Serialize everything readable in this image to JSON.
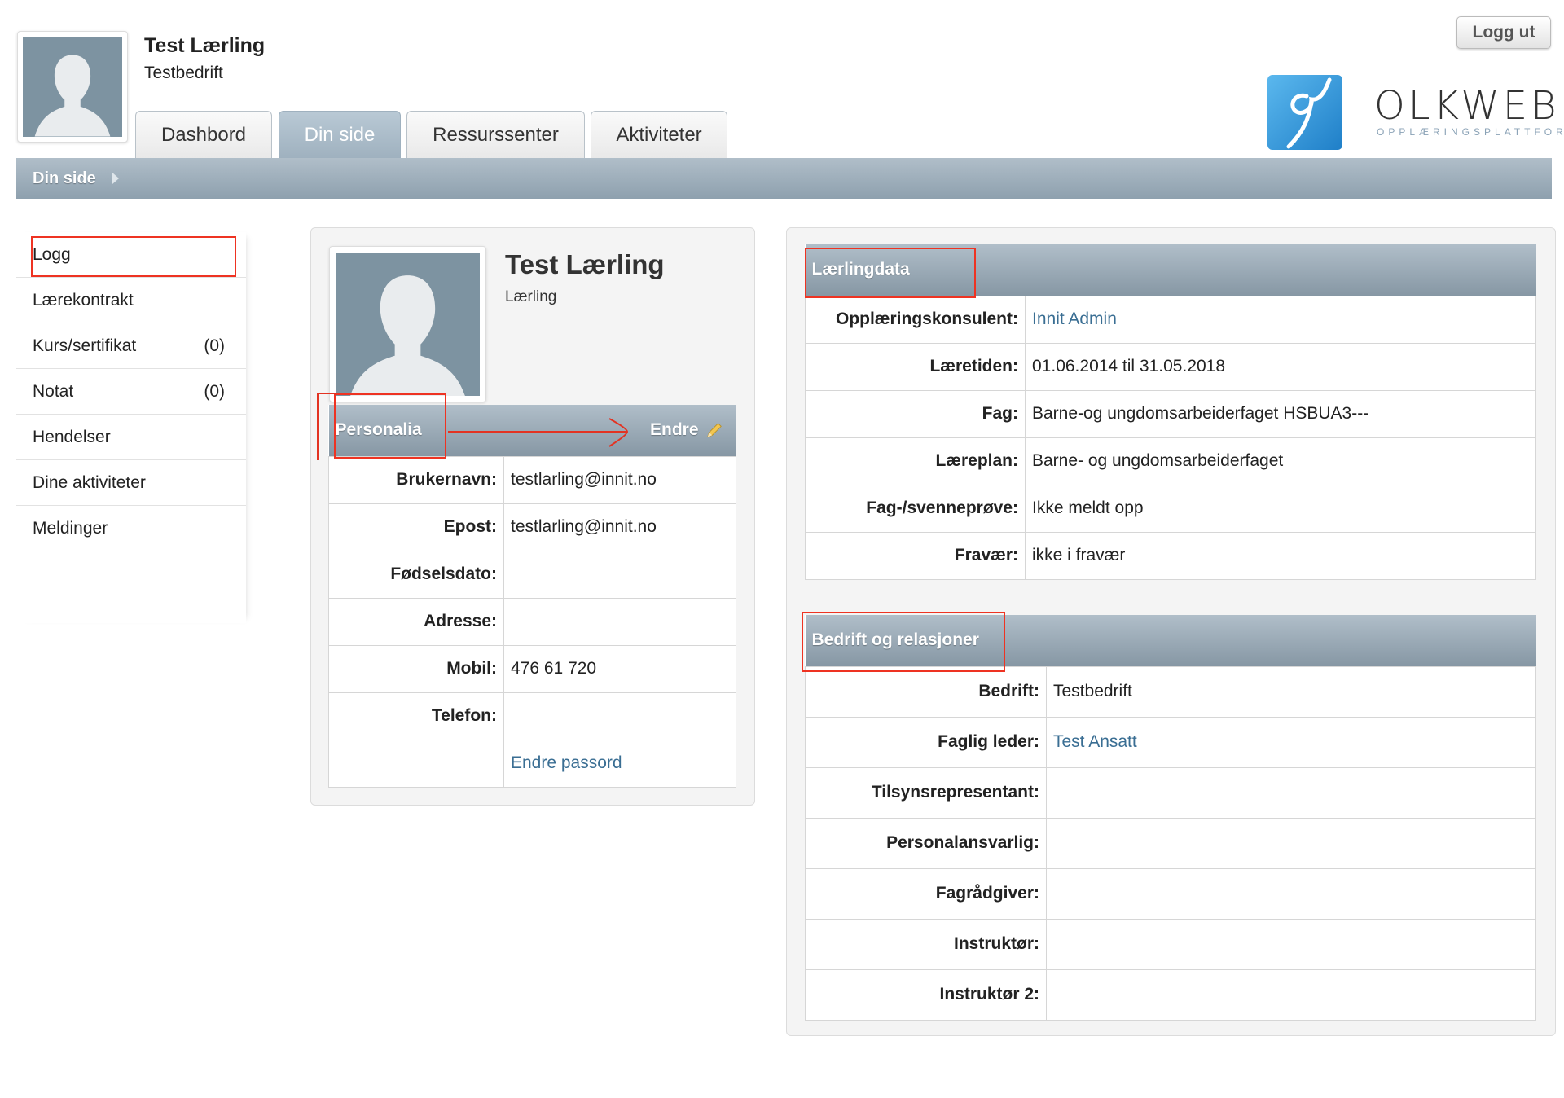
{
  "header": {
    "user_name": "Test Lærling",
    "company": "Testbedrift",
    "logout_label": "Logg ut",
    "logo_text": "OLKWEB",
    "logo_sub": "OPPLÆRINGSPLATTFORM"
  },
  "tabs": [
    {
      "label": "Dashbord",
      "active": false
    },
    {
      "label": "Din side",
      "active": true
    },
    {
      "label": "Ressurssenter",
      "active": false
    },
    {
      "label": "Aktiviteter",
      "active": false
    }
  ],
  "breadcrumb": {
    "current": "Din side"
  },
  "sidebar": {
    "items": [
      {
        "label": "Logg",
        "count": ""
      },
      {
        "label": "Lærekontrakt",
        "count": ""
      },
      {
        "label": "Kurs/sertifikat",
        "count": "(0)"
      },
      {
        "label": "Notat",
        "count": "(0)"
      },
      {
        "label": "Hendelser",
        "count": ""
      },
      {
        "label": "Dine aktiviteter",
        "count": ""
      },
      {
        "label": "Meldinger",
        "count": ""
      }
    ]
  },
  "profile": {
    "name": "Test Lærling",
    "role": "Lærling"
  },
  "personalia": {
    "title": "Personalia",
    "edit_label": "Endre",
    "rows": [
      {
        "label": "Brukernavn:",
        "value": "testlarling@innit.no"
      },
      {
        "label": "Epost:",
        "value": "testlarling@innit.no"
      },
      {
        "label": "Fødselsdato:",
        "value": ""
      },
      {
        "label": "Adresse:",
        "value": ""
      },
      {
        "label": "Mobil:",
        "value": "476 61 720"
      },
      {
        "label": "Telefon:",
        "value": ""
      }
    ],
    "password_link": "Endre passord"
  },
  "laerlingdata": {
    "title": "Lærlingdata",
    "rows": [
      {
        "label": "Opplæringskonsulent:",
        "value": "Innit Admin",
        "link": true
      },
      {
        "label": "Læretiden:",
        "value": "01.06.2014 til 31.05.2018",
        "link": false
      },
      {
        "label": "Fag:",
        "value": "Barne-og ungdomsarbeiderfaget HSBUA3---",
        "link": false
      },
      {
        "label": "Læreplan:",
        "value": "Barne- og ungdomsarbeiderfaget",
        "link": false
      },
      {
        "label": "Fag-/svenneprøve:",
        "value": "Ikke meldt opp",
        "link": false
      },
      {
        "label": "Fravær:",
        "value": "ikke i fravær",
        "link": false
      }
    ]
  },
  "bedrift": {
    "title": "Bedrift og relasjoner",
    "rows": [
      {
        "label": "Bedrift:",
        "value": "Testbedrift",
        "link": false
      },
      {
        "label": "Faglig leder:",
        "value": "Test Ansatt",
        "link": true
      },
      {
        "label": "Tilsynsrepresentant:",
        "value": "",
        "link": false
      },
      {
        "label": "Personalansvarlig:",
        "value": "",
        "link": false
      },
      {
        "label": "Fagrådgiver:",
        "value": "",
        "link": false
      },
      {
        "label": "Instruktør:",
        "value": "",
        "link": false
      },
      {
        "label": "Instruktør 2:",
        "value": "",
        "link": false
      }
    ]
  },
  "colors": {
    "header_bar": "#8ea0ae",
    "link": "#3a6e93",
    "annotation": "#e33322",
    "logo_blue": "#2a8fd6"
  }
}
